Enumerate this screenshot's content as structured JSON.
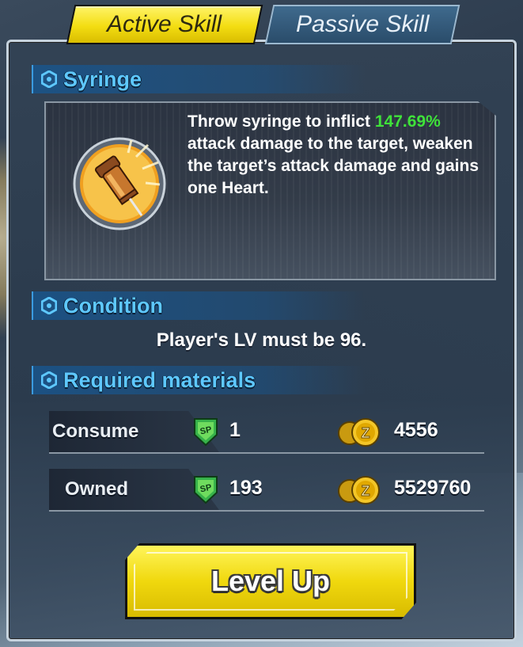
{
  "tabs": {
    "active": "Active Skill",
    "passive": "Passive Skill"
  },
  "skill": {
    "name": "Syringe",
    "description_part1": "Throw syringe to inflict ",
    "description_highlight": "147.69%",
    "description_part2": " attack damage to the target, weaken the target’s attack damage and gains one Heart.",
    "icon": "syringe-icon"
  },
  "condition": {
    "header": "Condition",
    "text": "Player's LV must be 96."
  },
  "materials": {
    "header": "Required materials",
    "rows": [
      {
        "label": "Consume",
        "sp": "1",
        "zeni": "4556"
      },
      {
        "label": "Owned",
        "sp": "193",
        "zeni": "5529760"
      }
    ],
    "sp_icon": "sp-badge-icon",
    "coin_icon": "zeni-coin-icon"
  },
  "button": {
    "level_up": "Level Up"
  },
  "colors": {
    "tab_active": "#f3dd12",
    "tab_passive": "#2a4c6a",
    "section_title": "#5ec8ff",
    "highlight": "#3fe23a",
    "button": "#f0d80e"
  }
}
